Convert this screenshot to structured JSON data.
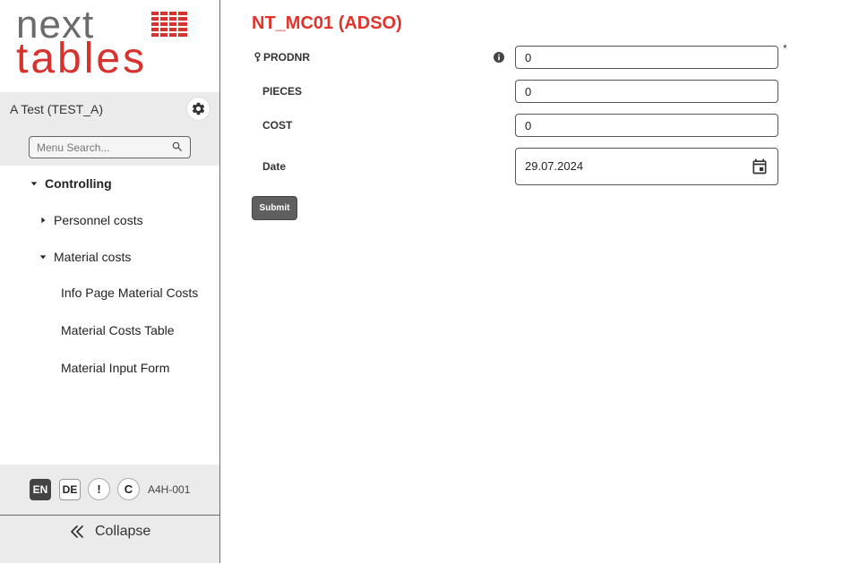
{
  "sidebar": {
    "logo": {
      "line1": "next",
      "line2": "tables"
    },
    "user": {
      "name": "A Test (TEST_A)"
    },
    "search": {
      "placeholder": "Menu Search..."
    },
    "nav": {
      "controlling": "Controlling",
      "personnel_costs": "Personnel costs",
      "material_costs": "Material costs",
      "info_page": "Info Page Material Costs",
      "costs_table": "Material Costs Table",
      "input_form": "Material Input Form"
    },
    "footer": {
      "lang_en": "EN",
      "lang_de": "DE",
      "alert": "!",
      "copyright": "C",
      "version": "A4H-001"
    },
    "collapse": "Collapse"
  },
  "main": {
    "title": "NT_MC01 (ADSO)",
    "fields": {
      "prodnr": {
        "label": "PRODNR",
        "value": "0"
      },
      "pieces": {
        "label": "PIECES",
        "value": "0"
      },
      "cost": {
        "label": "COST",
        "value": "0"
      },
      "date": {
        "label": "Date",
        "value": "29.07.2024"
      }
    },
    "required_mark": "*",
    "submit": "Submit"
  },
  "colors": {
    "brand_red": "#e0332c",
    "logo_gray": "#6b6b6b",
    "sidebar_bg": "#ebebeb"
  }
}
